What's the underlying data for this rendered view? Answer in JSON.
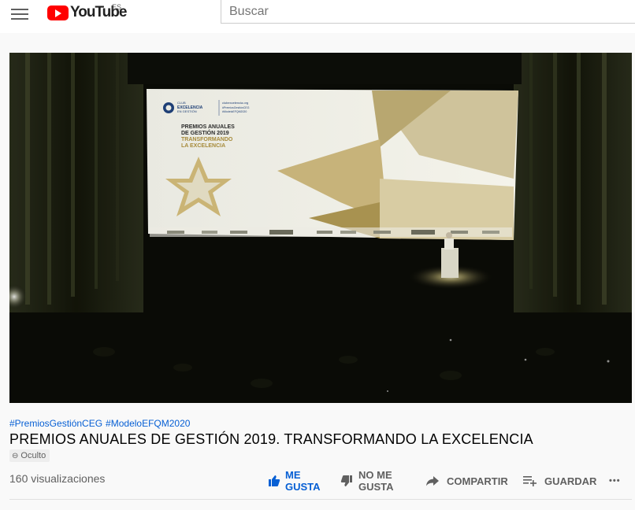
{
  "masthead": {
    "logo_text": "YouTube",
    "country_code": "ES",
    "search_placeholder": "Buscar"
  },
  "video": {
    "hashtags": [
      "#PremiosGestiónCEG",
      "#ModeloEFQM2020"
    ],
    "title": "PREMIOS ANUALES DE GESTIÓN 2019. TRANSFORMANDO LA EXCELENCIA",
    "privacy_badge": "Oculto",
    "views": "160 visualizaciones",
    "screen": {
      "club_line1": "CLUB",
      "club_line2": "EXCELENCIA",
      "club_line3": "EN GESTIÓN",
      "url": "clubexcelencia.org",
      "social1": "#PremiosGestiónCEG",
      "social2": "#ModeloEFQM2020",
      "heading1": "PREMIOS ANUALES",
      "heading2": "DE GESTIÓN 2019",
      "heading3": "TRANSFORMANDO",
      "heading4": "LA EXCELENCIA"
    }
  },
  "actions": {
    "like_line1": "ME",
    "like_line2": "GUSTA",
    "dislike_line1": "NO ME",
    "dislike_line2": "GUSTA",
    "share": "COMPARTIR",
    "save": "GUARDAR",
    "more": "•••"
  },
  "colors": {
    "brand_red": "#ff0000",
    "link_blue": "#065fd4",
    "active_blue": "#065fd4",
    "muted_text": "#606060"
  }
}
